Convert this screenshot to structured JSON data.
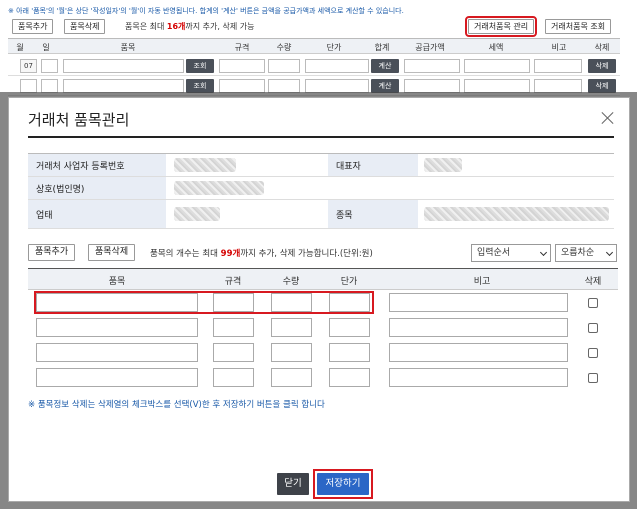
{
  "background": {
    "notice": "※ 아래 '품목'의 '월'은 상단 '작성일자'의 '월'이 자동 반영됩니다. 합계의 '계산' 버튼은 금액을 공급가액과 세액으로 계산할 수 있습니다.",
    "toolbar": {
      "add_item": "품목추가",
      "delete_item": "품목삭제",
      "limit_prefix": "품목은 최대",
      "limit_count": "16개",
      "limit_suffix": "까지 추가, 삭제 가능",
      "manage_vendor_items": "거래처품목 관리",
      "lookup_vendor_items": "거래처품목 조회"
    },
    "columns": [
      "월",
      "일",
      "품목",
      "규격",
      "수량",
      "단가",
      "합계",
      "공급가액",
      "세액",
      "비고",
      "삭제"
    ],
    "row_number": "07",
    "lookup_label": "조회",
    "calc_label": "계산",
    "delete_label": "삭제"
  },
  "modal": {
    "title": "거래처 품목관리",
    "fields": {
      "biz_no_label": "거래처 사업자 등록번호",
      "ceo_label": "대표자",
      "company_label": "상호(법인명)",
      "business_type_label": "업태",
      "business_item_label": "종목"
    },
    "toolbar": {
      "add_item": "품목추가",
      "delete_item": "품목삭제",
      "limit_prefix": "품목의 개수는 최대",
      "limit_count": "99개",
      "limit_suffix": "까지 추가, 삭제 가능합니다.(단위:원)",
      "sort_field": "입력순서",
      "sort_order": "오름차순"
    },
    "columns": [
      "품목",
      "규격",
      "수량",
      "단가",
      "비고",
      "삭제"
    ],
    "note": "※ 품목정보 삭제는 삭제열의 체크박스를 선택(V)한 후 저장하기 버튼을 클릭 합니다",
    "buttons": {
      "close": "닫기",
      "save": "저장하기"
    }
  }
}
